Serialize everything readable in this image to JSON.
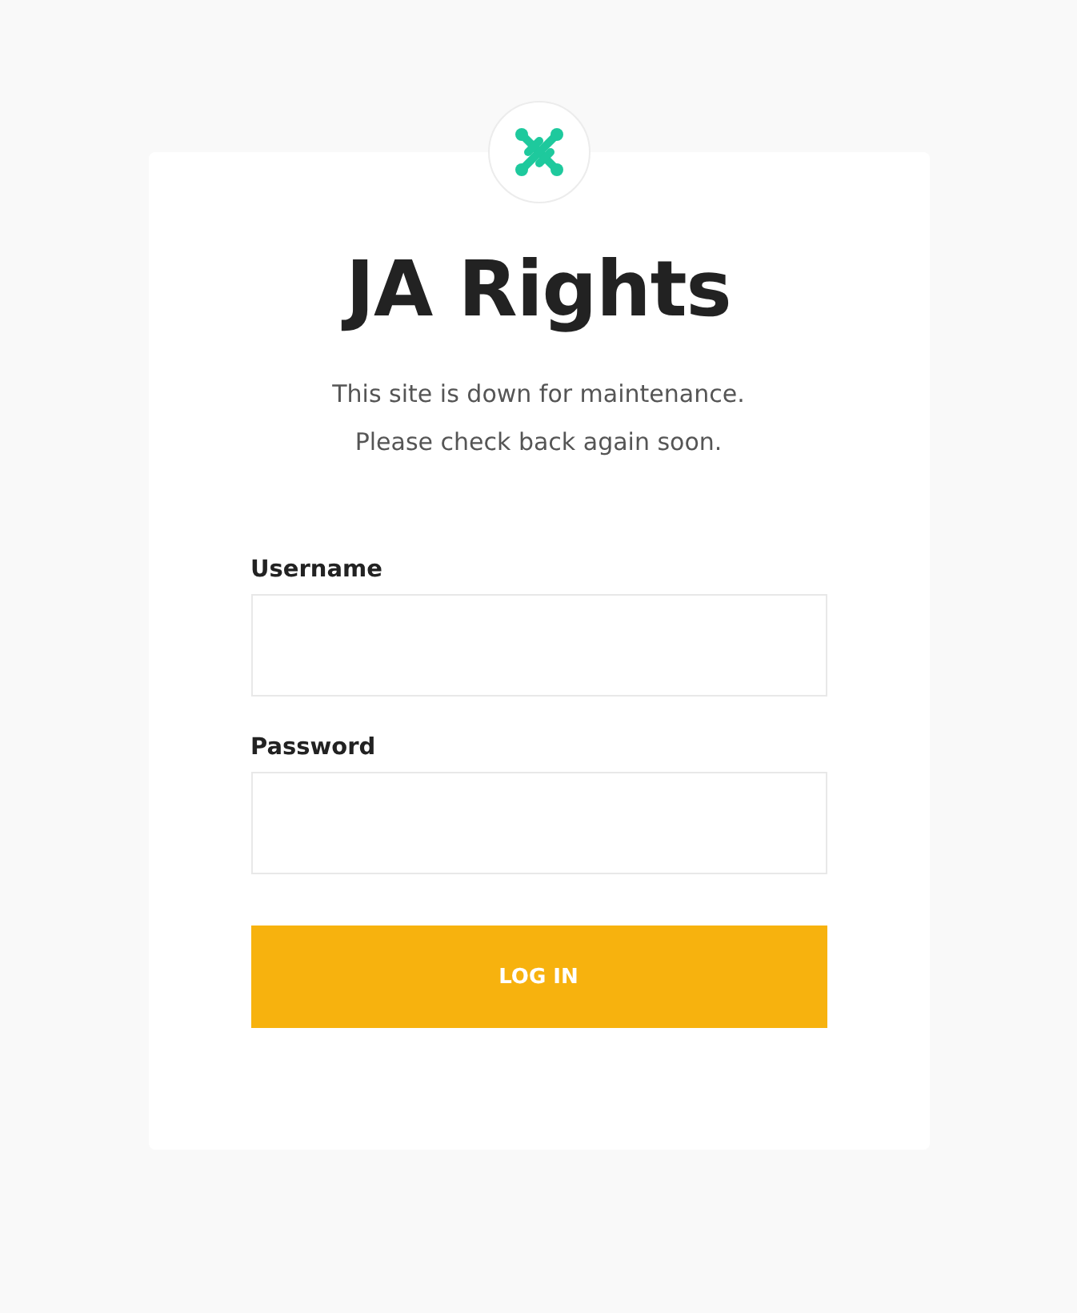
{
  "site": {
    "title": "JA Rights",
    "messages": [
      "This site is down for maintenance.",
      "Please check back again soon."
    ]
  },
  "form": {
    "fields": [
      {
        "label": "Username"
      },
      {
        "label": "Password"
      }
    ],
    "submit": "LOG IN"
  }
}
